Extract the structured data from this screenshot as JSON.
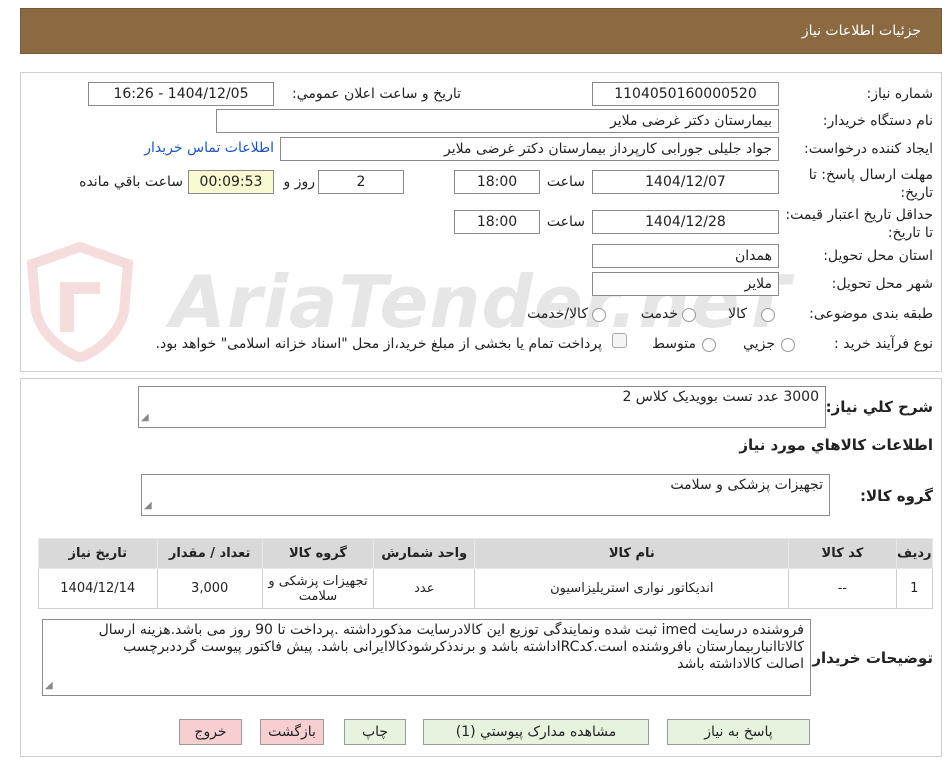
{
  "header": {
    "title": "جزئیات اطلاعات نیاز"
  },
  "need": {
    "number_label": "شماره نیاز:",
    "number": "1104050160000520",
    "announce_label": "تاریخ و ساعت اعلان عمومي:",
    "announce_value": "1404/12/05 - 16:26",
    "buyer_label": "نام دستگاه خریدار:",
    "buyer_value": "بیمارستان دکتر غرضی ملایر",
    "creator_label": "ایجاد کننده درخواست:",
    "creator_value": "جواد جلیلی جورابی کارپرداز بیمارستان دکتر غرضی ملایر",
    "contact_link": "اطلاعات تماس خریدار",
    "deadline_label": "مهلت ارسال پاسخ: تا تاریخ:",
    "deadline_date": "1404/12/07",
    "time_label": "ساعت",
    "deadline_time": "18:00",
    "days_value": "2",
    "days_label": "روز و",
    "remaining_time": "00:09:53",
    "remaining_label": "ساعت باقي مانده",
    "validity_label": "حداقل تاریخ اعتبار قیمت: تا تاریخ:",
    "validity_date": "1404/12/28",
    "validity_time": "18:00",
    "province_label": "استان محل تحویل:",
    "province_value": "همدان",
    "city_label": "شهر محل تحویل:",
    "city_value": "ملایر",
    "category_label": "طبقه بندی موضوعی:",
    "category_options": [
      "کالا",
      "خدمت",
      "کالا/خدمت"
    ],
    "process_label": "نوع فرآیند خرید :",
    "process_options": [
      "جزیي",
      "متوسط"
    ],
    "payment_note": "پرداخت تمام یا بخشی از مبلغ خرید،از محل \"اسناد خزانه اسلامی\" خواهد بود."
  },
  "summary": {
    "label": "شرح کلي نياز:",
    "value": "3000 عدد تست بوویدیک کلاس 2"
  },
  "goods": {
    "section_title": "اطلاعات کالاهاي مورد نياز",
    "group_label": "گروه کالا:",
    "group_value": "تجهیزات پزشکی و سلامت",
    "table": {
      "headers": [
        "رديف",
        "کد کالا",
        "نام کالا",
        "واحد شمارش",
        "گروه کالا",
        "تعداد / مقدار",
        "تاريخ نياز"
      ],
      "rows": [
        [
          "1",
          "--",
          "اندیکاتور نواری استریلیزاسیون",
          "عدد",
          "تجهیزات پزشکی و سلامت",
          "3,000",
          "1404/12/14"
        ]
      ]
    }
  },
  "notes": {
    "label": "توضیحات خریدار:",
    "line1": "فروشنده درسایت imed ثبت شده ونمایندگی توزیع این کالادرسایت مذکورداشته .پرداخت تا  90 روز می باشد.هزینه ارسال",
    "line2": "کالاتاانباربیمارستان بافروشنده است.کدIRCداشته باشد و برندذکرشودکالاایرانی باشد. پیش فاکتور پیوست گرددبرچسب",
    "line3": "اصالت کالاداشته باشد"
  },
  "buttons": {
    "reply": "پاسخ به نیاز",
    "attachments": "مشاهده مدارک پیوستي (1)",
    "print": "چاپ",
    "back": "بازگشت",
    "exit": "خروج"
  },
  "colors": {
    "header_bg": "#8b6a42",
    "button_green": "#e6f4df",
    "button_pink": "#f7cfd1",
    "timer_bg": "#fafad2",
    "link": "#1a55c8"
  },
  "watermark": {
    "text": "AriaTender.neT"
  }
}
